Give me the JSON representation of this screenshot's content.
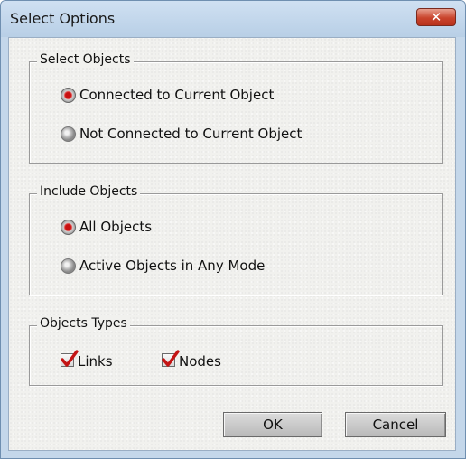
{
  "window": {
    "title": "Select Options",
    "close_glyph": "✕"
  },
  "select_objects": {
    "legend": "Select Objects",
    "options": [
      {
        "label": "Connected to Current Object",
        "selected": true
      },
      {
        "label": "Not Connected to Current Object",
        "selected": false
      }
    ]
  },
  "include_objects": {
    "legend": "Include Objects",
    "options": [
      {
        "label": "All Objects",
        "selected": true
      },
      {
        "label": "Active Objects in Any Mode",
        "selected": false
      }
    ]
  },
  "objects_types": {
    "legend": "Objects Types",
    "checkboxes": [
      {
        "label": "Links",
        "checked": true
      },
      {
        "label": "Nodes",
        "checked": true
      }
    ]
  },
  "buttons": {
    "ok": "OK",
    "cancel": "Cancel"
  },
  "colors": {
    "radio_selected": "#c81010",
    "check_mark": "#c41414",
    "close_button": "#c9442c"
  }
}
